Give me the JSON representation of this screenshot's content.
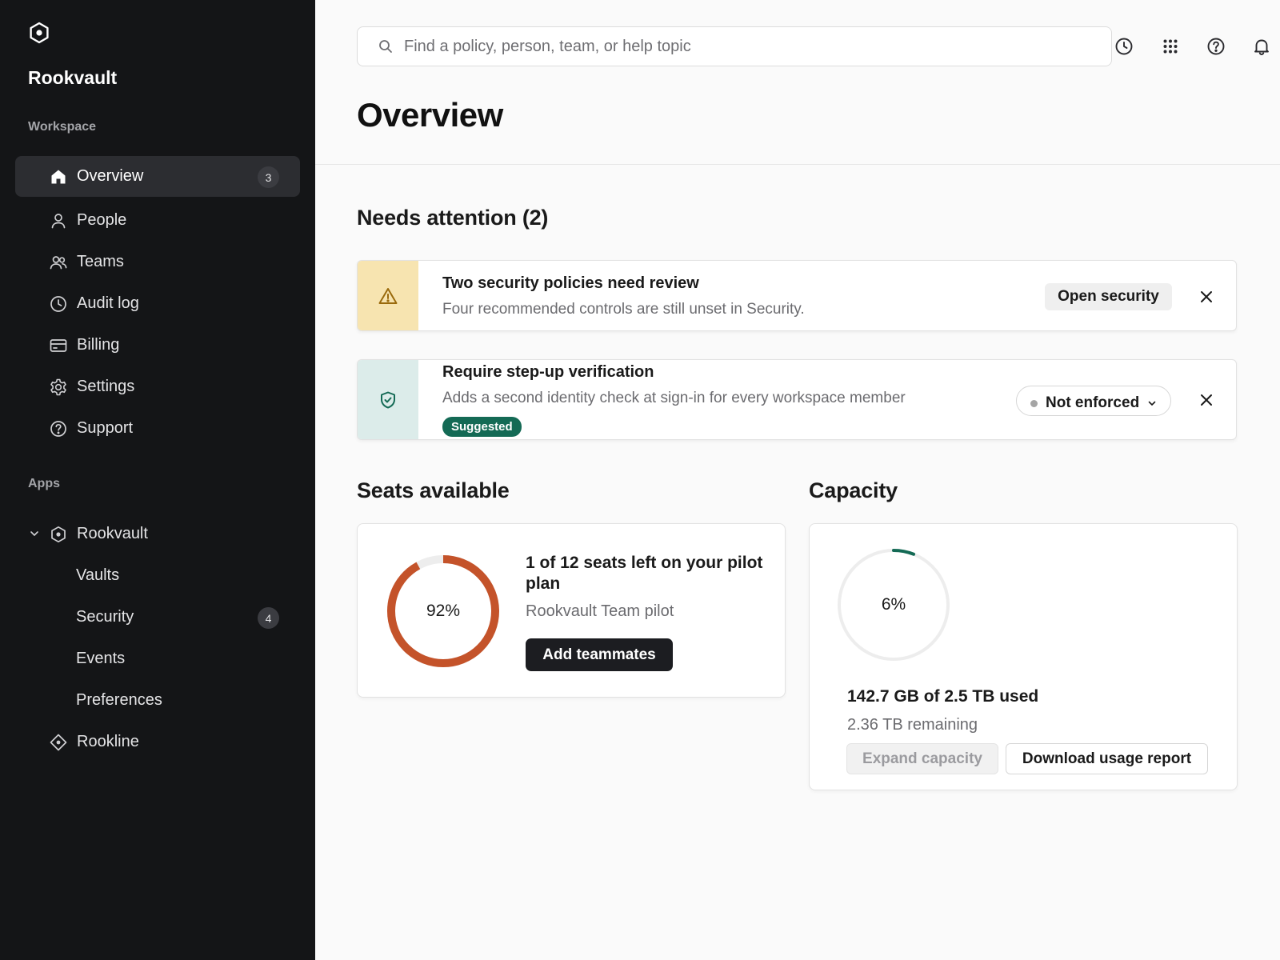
{
  "sidebar": {
    "brand": "Rookvault",
    "workspace_label": "Workspace",
    "apps_label": "Apps",
    "items": [
      {
        "label": "Overview",
        "icon": "home-icon",
        "badge": "3",
        "active": true
      },
      {
        "label": "People",
        "icon": "person-icon"
      },
      {
        "label": "Teams",
        "icon": "users-icon"
      },
      {
        "label": "Audit log",
        "icon": "clock-icon"
      },
      {
        "label": "Billing",
        "icon": "credit-card-icon"
      },
      {
        "label": "Settings",
        "icon": "gear-icon"
      },
      {
        "label": "Support",
        "icon": "help-circle-icon"
      }
    ],
    "apps": [
      {
        "label": "Rookvault",
        "icon": "hexagon-icon",
        "expanded": true,
        "children": [
          {
            "label": "Vaults"
          },
          {
            "label": "Security",
            "badge": "4"
          },
          {
            "label": "Events"
          },
          {
            "label": "Preferences"
          }
        ]
      },
      {
        "label": "Rookline",
        "icon": "diamond-icon"
      }
    ]
  },
  "topbar": {
    "search_placeholder": "Find a policy, person, team, or help topic",
    "icons": [
      "history-icon",
      "apps-grid-icon",
      "help-icon",
      "bell-icon"
    ]
  },
  "page": {
    "title": "Overview"
  },
  "attention": {
    "heading": "Needs attention (2)",
    "alerts": [
      {
        "title": "Two security policies need review",
        "description": "Four recommended controls are still unset in Security.",
        "action_label": "Open security",
        "icon": "warning-icon",
        "accent": "#f7e4b0"
      },
      {
        "title": "Require step-up verification",
        "description": "Adds a second identity check at sign-in for every workspace member",
        "tag": "Suggested",
        "select_value": "Not enforced",
        "icon": "shield-check-icon",
        "accent": "#dcecea"
      }
    ]
  },
  "seats": {
    "heading": "Seats available",
    "percent": 92,
    "percent_label": "92%",
    "title": "1 of 12 seats left on your pilot plan",
    "subtitle": "Rookvault Team pilot",
    "button_label": "Add teammates",
    "ring_color": "#c4532a"
  },
  "capacity": {
    "heading": "Capacity",
    "percent": 6,
    "percent_label": "6%",
    "title": "142.7 GB of 2.5 TB used",
    "subtitle": "2.36 TB remaining",
    "expand_label": "Expand capacity",
    "report_label": "Download usage report",
    "ring_color": "#146a55"
  }
}
